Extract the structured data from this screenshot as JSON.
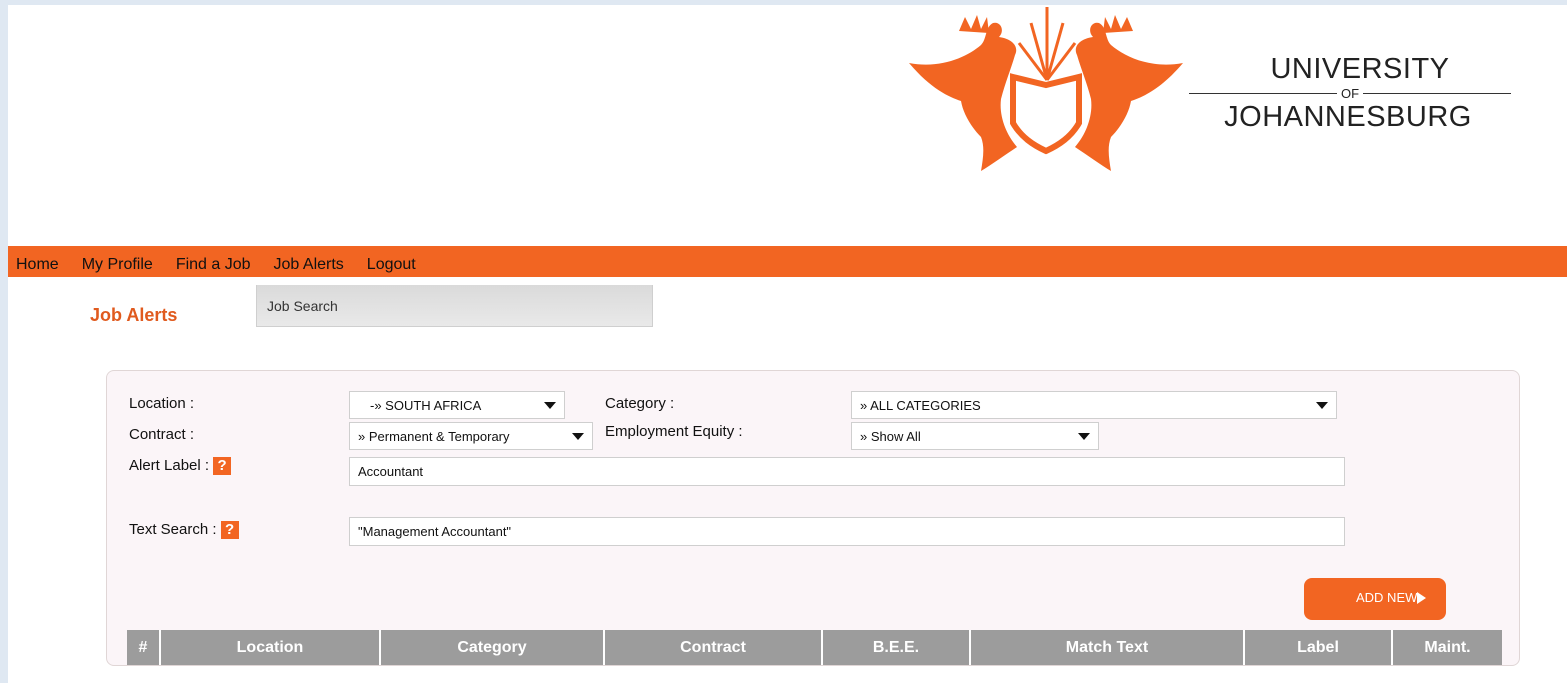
{
  "brand": {
    "line1": "UNIVERSITY",
    "line2": "OF",
    "line3": "JOHANNESBURG",
    "accent_color": "#f26522"
  },
  "nav": {
    "items": [
      {
        "label": "Home"
      },
      {
        "label": "My Profile"
      },
      {
        "label": "Find a Job"
      },
      {
        "label": "Job Alerts"
      },
      {
        "label": "Logout"
      }
    ]
  },
  "page": {
    "title": "Job Alerts",
    "tab": "Job Search"
  },
  "form": {
    "location_label": "Location :",
    "location_value": "-» SOUTH AFRICA",
    "category_label": "Category :",
    "category_value": "» ALL CATEGORIES",
    "contract_label": "Contract :",
    "contract_value": "» Permanent & Temporary",
    "equity_label": "Employment Equity :",
    "equity_value": "» Show All",
    "alert_label": "Alert Label :",
    "alert_value": "Accountant",
    "text_search_label": "Text Search :",
    "text_search_value": "\"Management Accountant\"",
    "help_glyph": "?",
    "add_button": "ADD NEW"
  },
  "table": {
    "headers": [
      "#",
      "Location",
      "Category",
      "Contract",
      "B.E.E.",
      "Match Text",
      "Label",
      "Maint."
    ]
  }
}
